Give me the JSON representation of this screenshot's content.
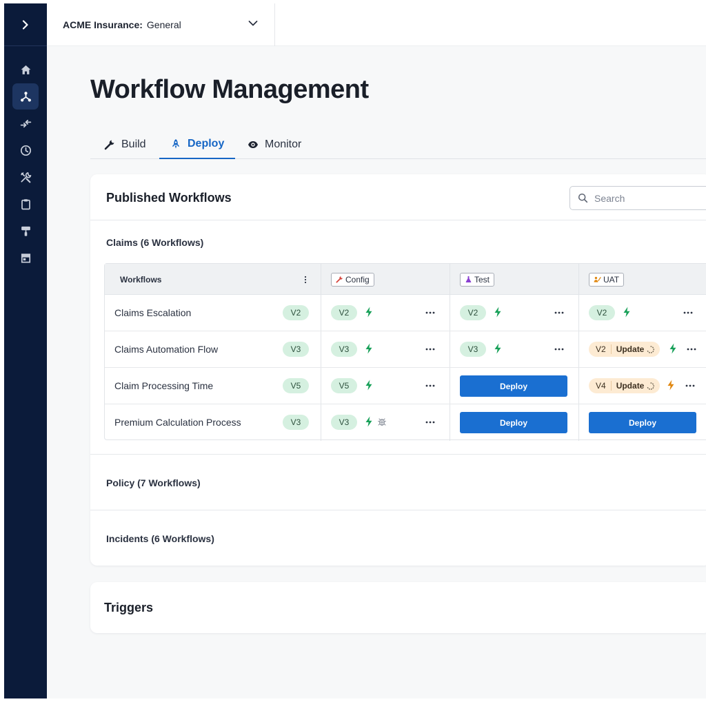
{
  "nav": {
    "expand_icon": "chevron-right-icon",
    "items": [
      {
        "icon": "home-icon",
        "active": false
      },
      {
        "icon": "workflow-icon",
        "active": true
      },
      {
        "icon": "transfer-icon",
        "active": false
      },
      {
        "icon": "clock-icon",
        "active": false
      },
      {
        "icon": "tools-icon",
        "active": false
      },
      {
        "icon": "clipboard-icon",
        "active": false
      },
      {
        "icon": "paint-roller-icon",
        "active": false
      },
      {
        "icon": "store-icon",
        "active": false
      }
    ]
  },
  "header": {
    "org_name": "ACME Insurance:",
    "workspace": "General"
  },
  "page": {
    "title": "Workflow Management"
  },
  "tabs": [
    {
      "label": "Build",
      "icon": "wrench-icon",
      "active": false
    },
    {
      "label": "Deploy",
      "icon": "rocket-icon",
      "active": true
    },
    {
      "label": "Monitor",
      "icon": "eye-icon",
      "active": false
    }
  ],
  "published": {
    "title": "Published Workflows",
    "search_placeholder": "Search",
    "groups": [
      {
        "label": "Claims (6 Workflows)"
      },
      {
        "label": "Policy (7 Workflows)"
      },
      {
        "label": "Incidents (6 Workflows)"
      }
    ],
    "table": {
      "workflows_header": "Workflows",
      "env_headers": [
        "Config",
        "Test",
        "UAT"
      ],
      "deploy_label": "Deploy",
      "update_label": "Update",
      "rows": [
        {
          "name": "Claims Escalation",
          "version": "V2",
          "config": "V2",
          "test": "V2",
          "uat": "V2",
          "uat_status": "deployed"
        },
        {
          "name": "Claims Automation Flow",
          "version": "V3",
          "config": "V3",
          "test": "V3",
          "uat": "V2",
          "uat_status": "update"
        },
        {
          "name": "Claim Processing Time",
          "version": "V5",
          "config": "V5",
          "test": "",
          "uat": "V4",
          "uat_status": "update"
        },
        {
          "name": "Premium Calculation Process",
          "version": "V3",
          "config": "V3",
          "test": "",
          "uat": "",
          "uat_status": "deploy"
        }
      ]
    }
  },
  "triggers": {
    "title": "Triggers"
  },
  "colors": {
    "sidebar": "#0b1b3a",
    "accent": "#1a6fd1",
    "version_pill": "#d5f0e0",
    "update_pill": "#fdebd3",
    "bolt_green": "#17a058",
    "bolt_orange": "#e0860e"
  }
}
